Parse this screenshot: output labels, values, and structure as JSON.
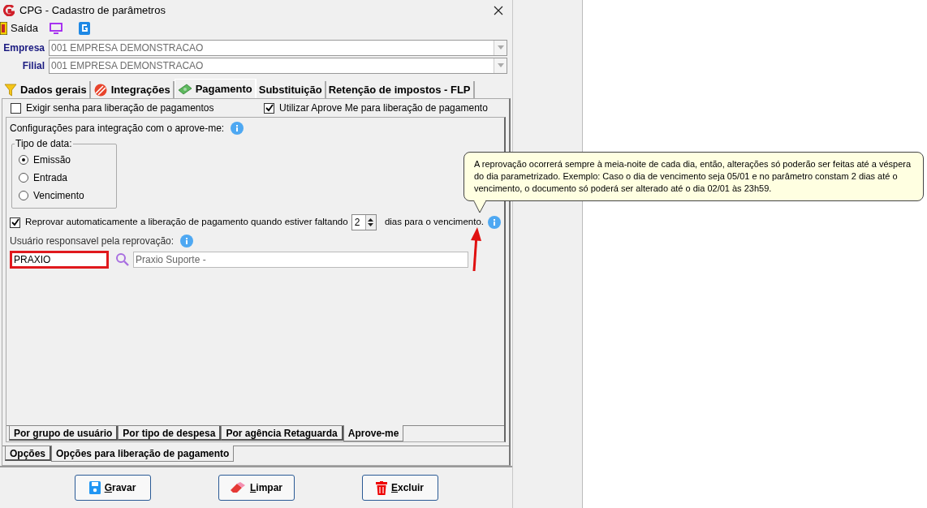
{
  "window": {
    "title": "CPG - Cadastro de parâmetros"
  },
  "toolbar": {
    "label": "Saída"
  },
  "fields": [
    {
      "label": "Empresa",
      "value": "001 EMPRESA DEMONSTRACAO",
      "disabled": true
    },
    {
      "label": "Filial",
      "value": "001 EMPRESA DEMONSTRACAO",
      "disabled": true
    }
  ],
  "tabs": [
    {
      "label": "Dados gerais",
      "selected": false
    },
    {
      "label": "Integrações",
      "selected": false
    },
    {
      "label": "Pagamento",
      "selected": true
    },
    {
      "label": "Substituição",
      "selected": false
    },
    {
      "label": "Retenção de impostos - FLP",
      "selected": false
    }
  ],
  "options": [
    {
      "label": "Exigir senha para liberação de pagamentos",
      "checked": false
    },
    {
      "label": "Utilizar Aprove Me para liberação de pagamento",
      "checked": true
    }
  ],
  "section_label": "Configurações para integração com o aprove-me:",
  "date_type": {
    "legend": "Tipo de data:",
    "options": [
      {
        "label": "Emissão",
        "selected": true
      },
      {
        "label": "Entrada",
        "selected": false
      },
      {
        "label": "Vencimento",
        "selected": false
      }
    ]
  },
  "auto_reject": {
    "checked": true,
    "label_before": "Reprovar automaticamente a liberação de pagamento quando estiver faltando",
    "days": "2",
    "label_after": "dias para o vencimento."
  },
  "responsible": {
    "label": "Usuário responsavel pela reprovação:",
    "code": "PRAXIO",
    "name": "Praxio Suporte -"
  },
  "tooltip": {
    "text": "A reprovação ocorrerá sempre à meia-noite de cada dia, então, alterações só poderão ser feitas até a véspera do dia parametrizado. Exemplo: Caso o dia de vencimento seja 05/01 e no parâmetro constam 2 dias até o vencimento, o documento só poderá ser alterado até o dia 02/01 às 23h59."
  },
  "inner_tabs": [
    {
      "label": "Por grupo de usuário",
      "selected": false
    },
    {
      "label": "Por tipo de despesa",
      "selected": false
    },
    {
      "label": "Por agência Retaguarda",
      "selected": false
    },
    {
      "label": "Aprove-me",
      "selected": true
    }
  ],
  "outer_tabs": [
    {
      "label": "Opções",
      "selected": false
    },
    {
      "label": "Opções para liberação de pagamento",
      "selected": true
    }
  ],
  "buttons": [
    {
      "label": "Gravar"
    },
    {
      "label": "Limpar"
    },
    {
      "label": "Excluir"
    }
  ]
}
